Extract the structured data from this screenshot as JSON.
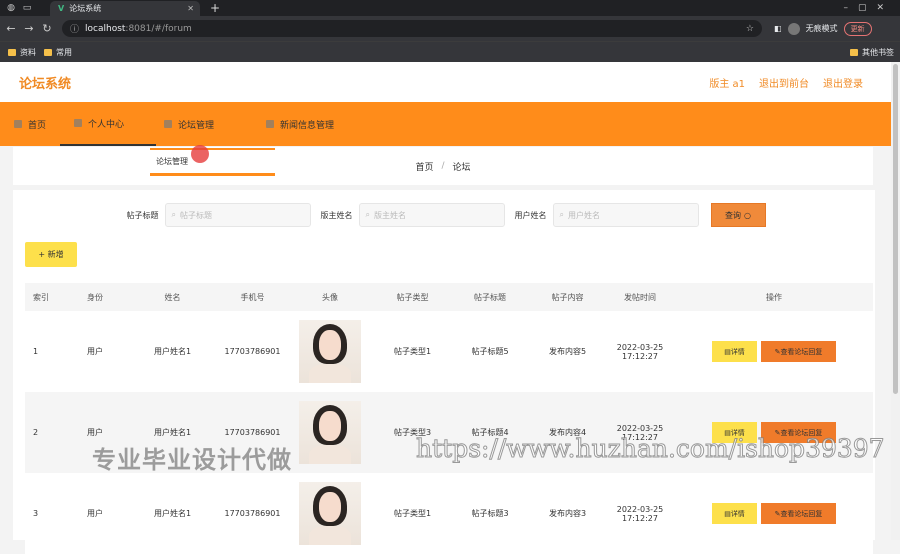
{
  "browser": {
    "tab_title": "论坛系统",
    "url_host": "localhost",
    "url_rest": ":8081/#/forum",
    "incognito_label": "无痕模式",
    "update_label": "更新",
    "bookmarks": [
      "资料",
      "常用"
    ],
    "other_bookmarks": "其他书签"
  },
  "header": {
    "brand": "论坛系统",
    "user_label": "版主 a1",
    "backend_link": "退出到前台",
    "logout_link": "退出登录"
  },
  "menu": {
    "items": [
      {
        "label": "首页"
      },
      {
        "label": "个人中心"
      },
      {
        "label": "论坛管理"
      },
      {
        "label": "新闻信息管理"
      }
    ],
    "dropdown_item": "论坛管理"
  },
  "breadcrumb": {
    "home": "首页",
    "separator": "/",
    "current": "论坛"
  },
  "search": {
    "fields": [
      {
        "label": "帖子标题",
        "placeholder": "帖子标题"
      },
      {
        "label": "版主姓名",
        "placeholder": "版主姓名"
      },
      {
        "label": "用户姓名",
        "placeholder": "用户姓名"
      }
    ],
    "button_label": "查询"
  },
  "add_button": "+ 新增",
  "table": {
    "headers": [
      "索引",
      "身份",
      "姓名",
      "手机号",
      "头像",
      "帖子类型",
      "帖子标题",
      "帖子内容",
      "发帖时间",
      "操作"
    ],
    "rows": [
      {
        "index": "1",
        "role": "用户",
        "name": "用户姓名1",
        "phone": "17703786901",
        "type": "帖子类型1",
        "title": "帖子标题5",
        "content": "发布内容5",
        "time": "2022-03-25 17:12:27"
      },
      {
        "index": "2",
        "role": "用户",
        "name": "用户姓名1",
        "phone": "17703786901",
        "type": "帖子类型3",
        "title": "帖子标题4",
        "content": "发布内容4",
        "time": "2022-03-25 17:12:27"
      },
      {
        "index": "3",
        "role": "用户",
        "name": "用户姓名1",
        "phone": "17703786901",
        "type": "帖子类型1",
        "title": "帖子标题3",
        "content": "发布内容3",
        "time": "2022-03-25 17:12:27"
      }
    ],
    "detail_label": "详情",
    "reply_label": "查看论坛回复"
  },
  "watermark": {
    "text": "专业毕业设计代做",
    "url": "https://www.huzhan.com/ishop39397"
  }
}
